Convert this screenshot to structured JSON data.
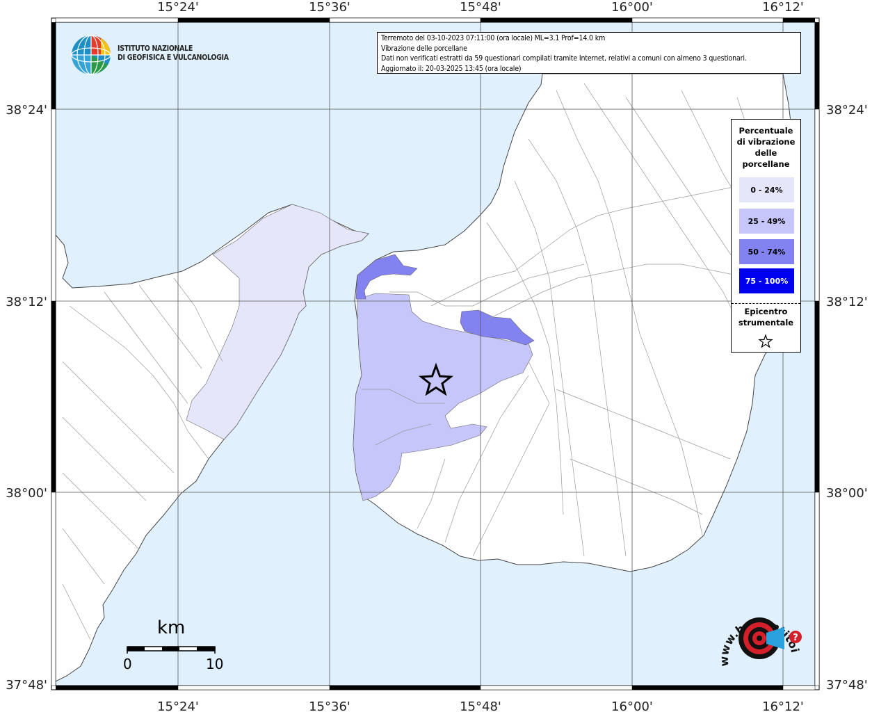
{
  "map": {
    "top_labels": [
      "15°24'",
      "15°36'",
      "15°48'",
      "16°00'",
      "16°12'"
    ],
    "bottom_labels": [
      "15°24'",
      "15°36'",
      "15°48'",
      "16°00'",
      "16°12'"
    ],
    "left_labels": [
      "38°24'",
      "38°12'",
      "38°00'",
      "37°48'"
    ],
    "right_labels": [
      "38°24'",
      "38°12'",
      "38°00'",
      "37°48'"
    ],
    "colors": {
      "sea": "#e0f0fc",
      "land": "#ffffff",
      "class_0_24": "#e6e6fb",
      "class_25_49": "#c6c6fa",
      "class_50_74": "#8282f0",
      "class_75_100": "#0000f0"
    }
  },
  "info": {
    "line1": "Terremoto del 03-10-2023 07:11:00 (ora locale) ML=3.1 Prof=14.0 km",
    "line2": "Vibrazione delle porcellane",
    "line3": "Dati non verificati estratti da 59 questionari compilati tramite Internet, relativi a comuni con almeno 3 questionari.",
    "line4": "Aggiornato il: 20-03-2025 13:45 (ora locale)"
  },
  "ingv": {
    "line1": "ISTITUTO NAZIONALE",
    "line2": "DI GEOFISICA E VULCANOLOGIA"
  },
  "legend": {
    "title_lines": [
      "Percentuale",
      "di vibrazione",
      "delle",
      "porcellane"
    ],
    "items": [
      {
        "label": "0 - 24%",
        "color": "#e6e6fb",
        "text_color": "#000000"
      },
      {
        "label": "25 - 49%",
        "color": "#c6c6fa",
        "text_color": "#000000"
      },
      {
        "label": "50 - 74%",
        "color": "#8282f0",
        "text_color": "#000000"
      },
      {
        "label": "75 - 100%",
        "color": "#0000f0",
        "text_color": "#ffffff"
      }
    ],
    "epicenter_lines": [
      "Epicentro",
      "strumentale"
    ]
  },
  "scale": {
    "unit": "km",
    "min": "0",
    "max": "10"
  },
  "hst": {
    "text": "www.haisentitoilterremoto.it"
  }
}
